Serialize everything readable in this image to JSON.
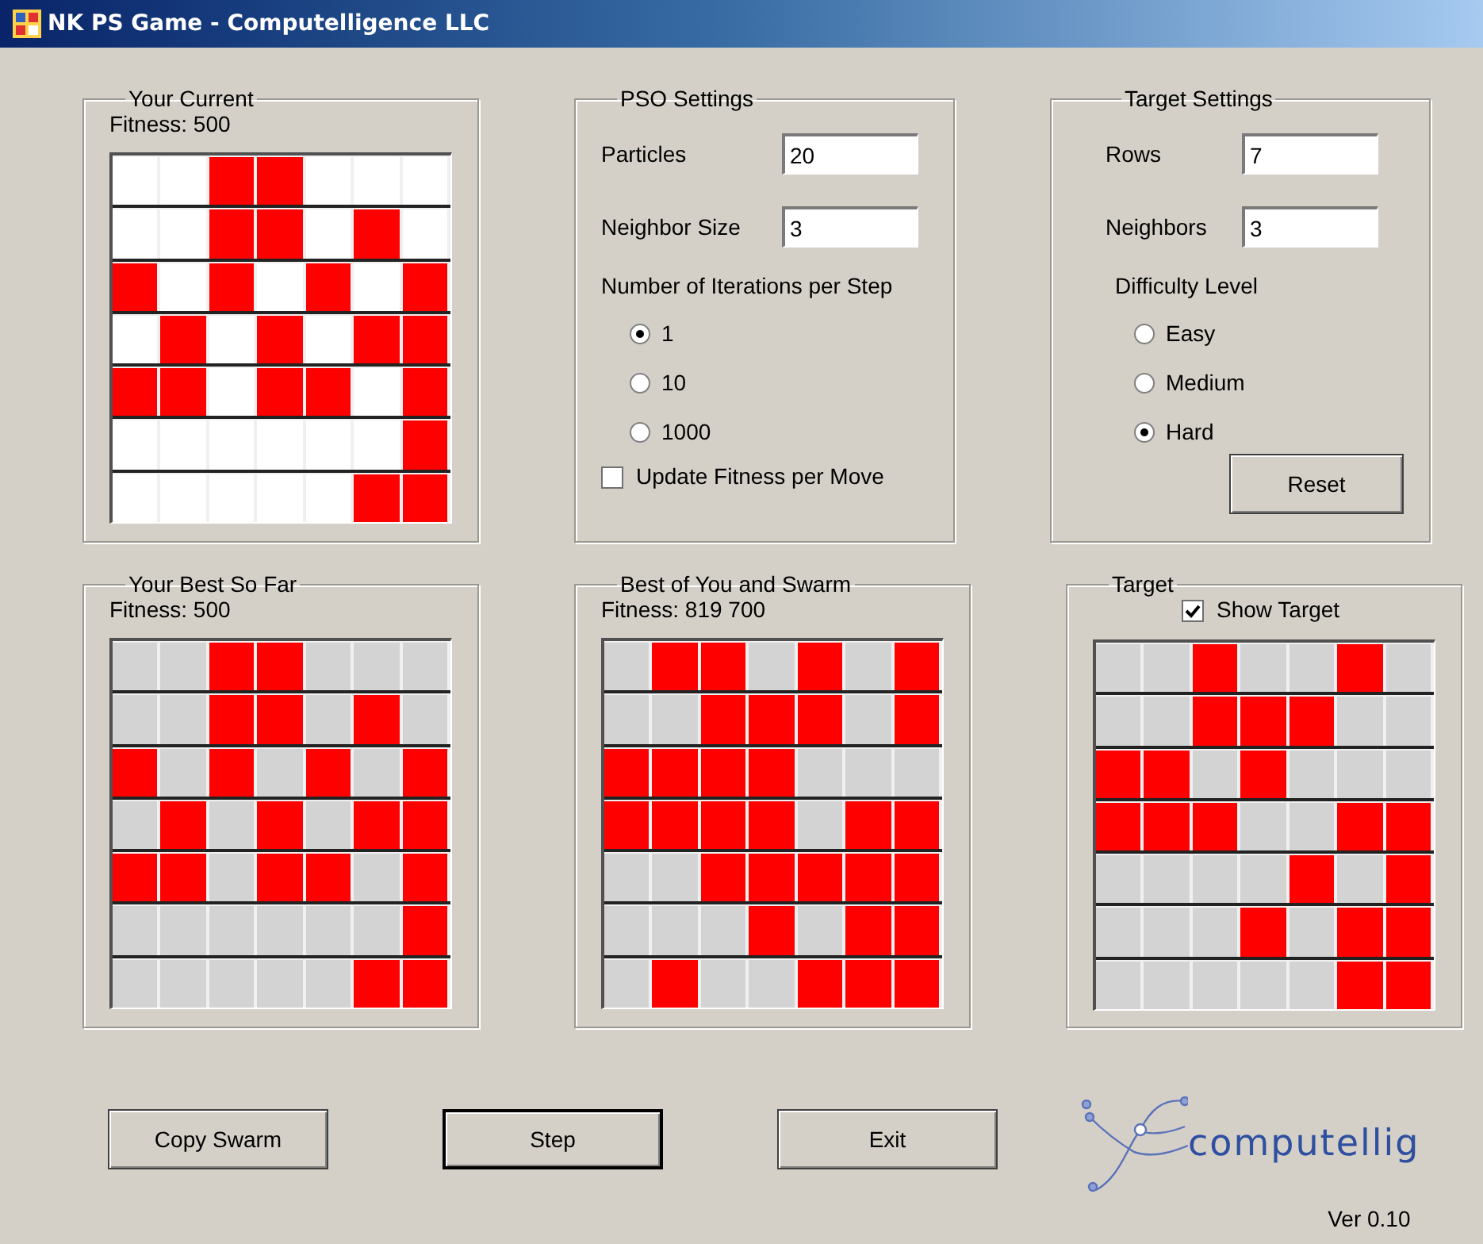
{
  "window": {
    "title": "NK PS Game - Computelligence LLC"
  },
  "current": {
    "legend": "Your Current",
    "fitness": "Fitness: 500",
    "kind": "editable",
    "grid": [
      [
        false,
        false,
        true,
        true,
        false,
        false,
        false
      ],
      [
        false,
        false,
        true,
        true,
        false,
        true,
        false
      ],
      [
        true,
        false,
        true,
        false,
        true,
        false,
        true
      ],
      [
        false,
        true,
        false,
        true,
        false,
        true,
        true
      ],
      [
        true,
        true,
        false,
        true,
        true,
        false,
        true
      ],
      [
        false,
        false,
        false,
        false,
        false,
        false,
        true
      ],
      [
        false,
        false,
        false,
        false,
        false,
        true,
        true
      ]
    ]
  },
  "pso_settings": {
    "legend": "PSO Settings",
    "fields": [
      {
        "label": "Particles",
        "value": "20"
      },
      {
        "label": "Neighbor Size",
        "value": "3"
      }
    ],
    "iterations_label": "Number of Iterations per Step",
    "iterations": [
      {
        "label": "1",
        "selected": true
      },
      {
        "label": "10",
        "selected": false
      },
      {
        "label": "1000",
        "selected": false
      }
    ],
    "update_fitness": {
      "label": "Update Fitness per Move",
      "checked": false
    }
  },
  "target_settings": {
    "legend": "Target Settings",
    "fields": [
      {
        "label": "Rows",
        "value": "7"
      },
      {
        "label": "Neighbors",
        "value": "3"
      }
    ],
    "difficulty_label": "Difficulty Level",
    "difficulty": [
      {
        "label": "Easy",
        "selected": false
      },
      {
        "label": "Medium",
        "selected": false
      },
      {
        "label": "Hard",
        "selected": true
      }
    ],
    "reset": "Reset"
  },
  "best_so_far": {
    "legend": "Your Best So Far",
    "fitness": "Fitness: 500",
    "kind": "display",
    "grid": [
      [
        false,
        false,
        true,
        true,
        false,
        false,
        false
      ],
      [
        false,
        false,
        true,
        true,
        false,
        true,
        false
      ],
      [
        true,
        false,
        true,
        false,
        true,
        false,
        true
      ],
      [
        false,
        true,
        false,
        true,
        false,
        true,
        true
      ],
      [
        true,
        true,
        false,
        true,
        true,
        false,
        true
      ],
      [
        false,
        false,
        false,
        false,
        false,
        false,
        true
      ],
      [
        false,
        false,
        false,
        false,
        false,
        true,
        true
      ]
    ]
  },
  "best_swarm": {
    "legend": "Best of You and Swarm",
    "fitness": "Fitness: 819 700",
    "kind": "display",
    "grid": [
      [
        false,
        true,
        true,
        false,
        true,
        false,
        true
      ],
      [
        false,
        false,
        true,
        true,
        true,
        false,
        true
      ],
      [
        true,
        true,
        true,
        true,
        false,
        false,
        false
      ],
      [
        true,
        true,
        true,
        true,
        false,
        true,
        true
      ],
      [
        false,
        false,
        true,
        true,
        true,
        true,
        true
      ],
      [
        false,
        false,
        false,
        true,
        false,
        true,
        true
      ],
      [
        false,
        true,
        false,
        false,
        true,
        true,
        true
      ]
    ]
  },
  "target": {
    "legend": "Target",
    "show_target": {
      "label": "Show Target",
      "checked": true
    },
    "kind": "display",
    "grid": [
      [
        false,
        false,
        true,
        false,
        false,
        true,
        false
      ],
      [
        false,
        false,
        true,
        true,
        true,
        false,
        false
      ],
      [
        true,
        true,
        false,
        true,
        false,
        false,
        false
      ],
      [
        true,
        true,
        true,
        false,
        false,
        true,
        true
      ],
      [
        false,
        false,
        false,
        false,
        true,
        false,
        true
      ],
      [
        false,
        false,
        false,
        true,
        false,
        true,
        true
      ],
      [
        false,
        false,
        false,
        false,
        false,
        true,
        true
      ]
    ]
  },
  "buttons": [
    {
      "label": "Copy Swarm",
      "focused": false
    },
    {
      "label": "Step",
      "focused": true
    },
    {
      "label": "Exit",
      "focused": false
    }
  ],
  "logo_text": "computellig",
  "version": "Ver 0.10"
}
